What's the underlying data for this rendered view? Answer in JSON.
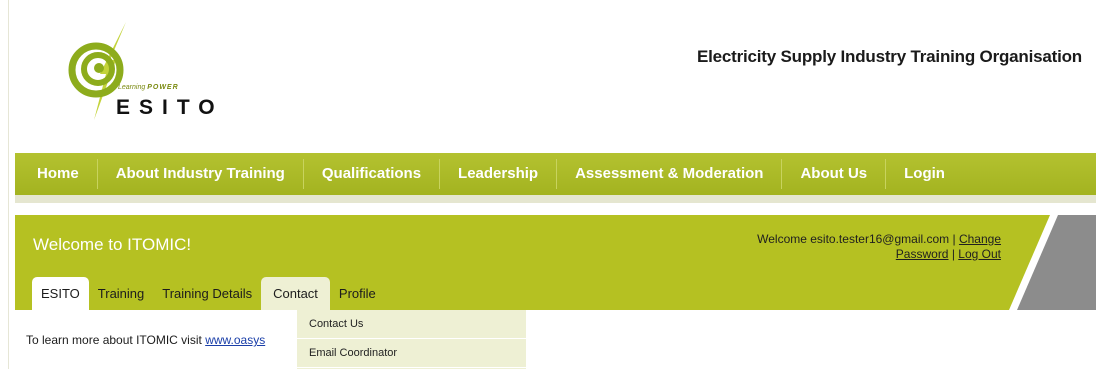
{
  "logo": {
    "tagline_prefix": "Learning",
    "tagline_power": "POWER",
    "wordmark": "ESITO",
    "colors": {
      "swirl": "#8dac1c",
      "lightning": "#c3d33a"
    }
  },
  "header": {
    "org_name": "Electricity Supply Industry Training Organisation"
  },
  "main_nav": {
    "items": [
      {
        "label": "Home"
      },
      {
        "label": "About Industry Training"
      },
      {
        "label": "Qualifications"
      },
      {
        "label": "Leadership"
      },
      {
        "label": "Assessment & Moderation"
      },
      {
        "label": "About Us"
      },
      {
        "label": "Login"
      }
    ]
  },
  "welcome": {
    "title": "Welcome to ITOMIC!",
    "greeting": "Welcome esito.tester16@gmail.com |",
    "change_password_part1": "Change",
    "change_password_part2": "Password",
    "separator": "|",
    "logout": "Log Out"
  },
  "sub_tabs": {
    "items": [
      {
        "label": "ESITO",
        "state": "active"
      },
      {
        "label": "Training"
      },
      {
        "label": "Training Details"
      },
      {
        "label": "Contact",
        "state": "open"
      },
      {
        "label": "Profile"
      }
    ]
  },
  "content": {
    "intro_text": "To learn more about ITOMIC visit",
    "intro_link": "www.oasys"
  },
  "dropdown": {
    "items": [
      {
        "label": "Contact Us"
      },
      {
        "label": "Email Coordinator"
      }
    ]
  },
  "colors": {
    "nav_green": "#a8b825",
    "bar_green": "#b5c122",
    "dropdown_bg": "#eef0d4",
    "grey_accent": "#8c8c8c"
  }
}
